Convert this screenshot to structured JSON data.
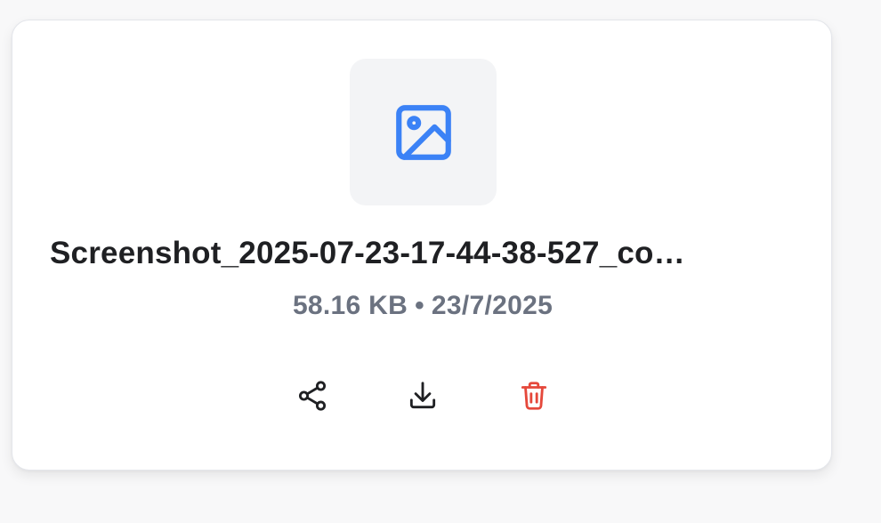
{
  "file": {
    "name": "Screenshot_2025-07-23-17-44-38-527_co…",
    "size": "58.16 KB",
    "separator": "•",
    "date": "23/7/2025"
  },
  "icons": {
    "thumbnail": "image-icon",
    "share": "share-icon",
    "download": "download-icon",
    "delete": "trash-icon"
  },
  "colors": {
    "thumbnail_icon": "#3b82f6",
    "delete_icon": "#e5483b",
    "meta_text": "#6b7280",
    "title_text": "#1f2023"
  }
}
